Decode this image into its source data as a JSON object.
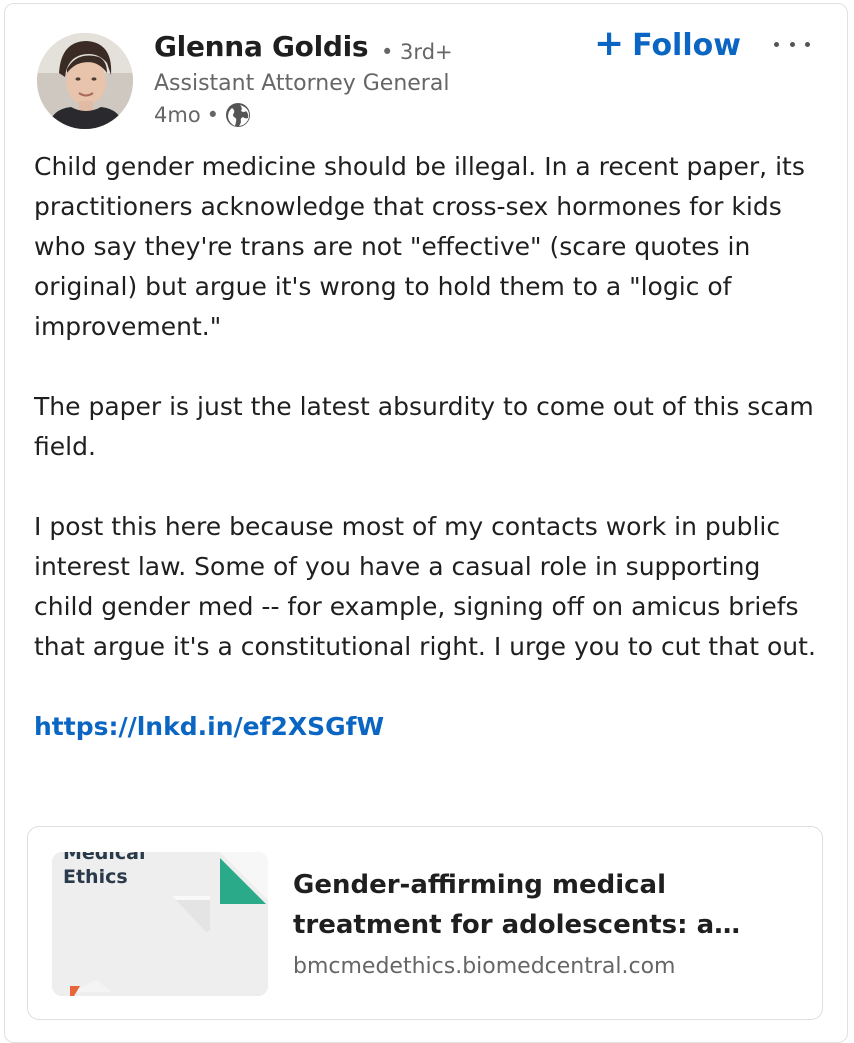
{
  "author": {
    "name": "Glenna Goldis",
    "degree": "• 3rd+",
    "headline": "Assistant Attorney General",
    "time": "4mo",
    "visibility_icon": "globe-icon"
  },
  "actions": {
    "follow_label": "Follow",
    "follow_icon": "plus-icon",
    "more_icon": "more-options-icon"
  },
  "post": {
    "paragraphs": [
      "Child gender medicine should be illegal. In a recent paper, its practitioners acknowledge that cross-sex hormones for kids who say they're trans are not \"effective\" (scare quotes in original) but argue it's wrong to hold them to a \"logic of improvement.\"",
      "The paper is just the latest absurdity to come out of this scam field.",
      "I post this here because most of my contacts work in public interest law. Some of you have a casual role in supporting child gender med -- for example, signing off on amicus briefs that argue it's a constitutional right. I urge you to cut that out."
    ],
    "link": "https://lnkd.in/ef2XSGfW"
  },
  "link_preview": {
    "thumb_text_line1": "Medical",
    "thumb_text_line2": "Ethics",
    "title": "Gender-affirming medical treatment for adolescents: a…",
    "source": "bmcmedethics.biomedcentral.com"
  },
  "colors": {
    "accent": "#0a66c2",
    "text": "#1f1f1f",
    "muted": "#666666",
    "thumb_green": "#2baa8a",
    "thumb_orange": "#e8643a"
  }
}
